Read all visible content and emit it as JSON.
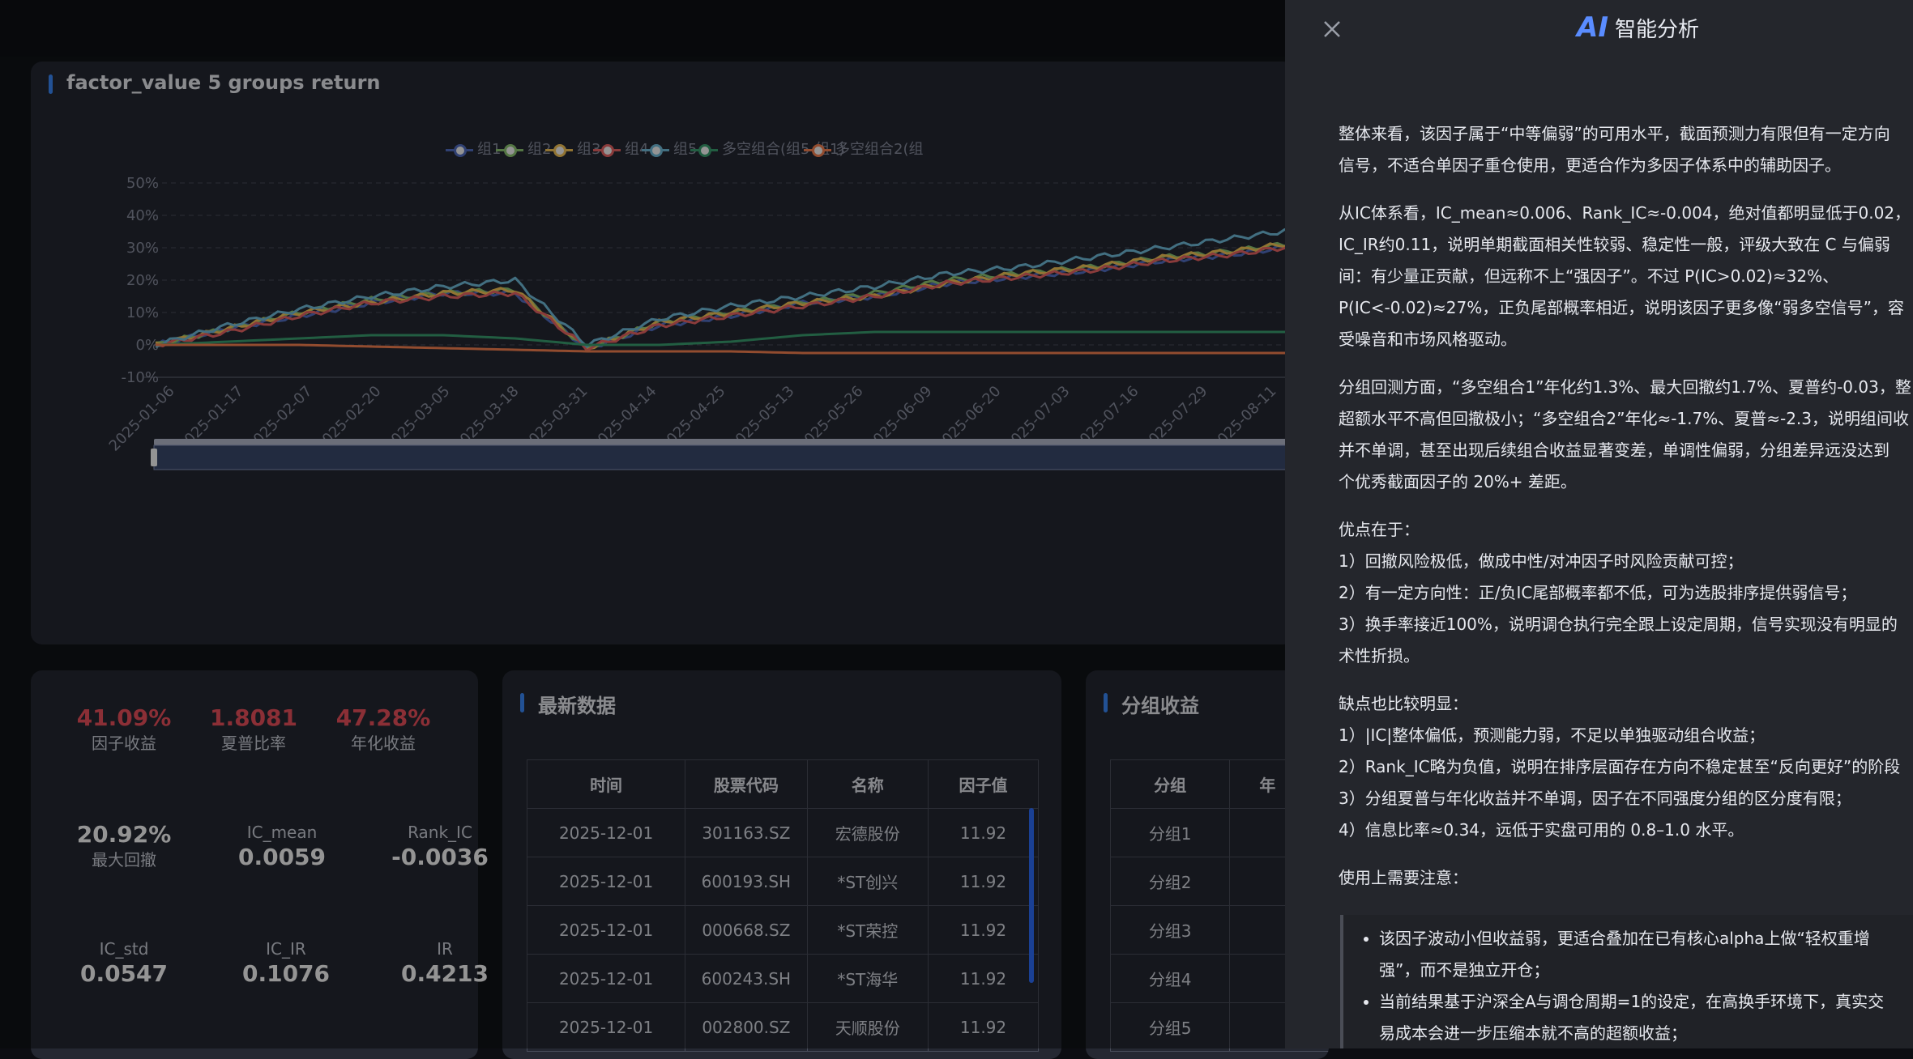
{
  "chart_card": {
    "title": "factor_value 5 groups return"
  },
  "chart_data": {
    "type": "line",
    "title": "factor_value 5 groups return",
    "ylim": [
      -10,
      50
    ],
    "yticks": [
      "50%",
      "40%",
      "30%",
      "20%",
      "10%",
      "0%",
      "-10%"
    ],
    "x": [
      "2025-01-06",
      "2025-01-17",
      "2025-02-07",
      "2025-02-20",
      "2025-03-05",
      "2025-03-18",
      "2025-03-31",
      "2025-04-14",
      "2025-04-25",
      "2025-05-13",
      "2025-05-26",
      "2025-06-09",
      "2025-06-20",
      "2025-07-03",
      "2025-07-16",
      "2025-07-29",
      "2025-08-11"
    ],
    "legend_position": "top-right",
    "grid": true,
    "series": [
      {
        "name": "组1",
        "color": "#5470c6",
        "values": [
          0,
          5,
          9,
          13,
          16,
          16,
          -1,
          6,
          9,
          13,
          15,
          19,
          21,
          23,
          26,
          28,
          31
        ]
      },
      {
        "name": "组2",
        "color": "#91cc75",
        "values": [
          0,
          5,
          10,
          14,
          16,
          17,
          -1,
          7,
          10,
          13,
          16,
          20,
          22,
          24,
          27,
          29,
          32
        ]
      },
      {
        "name": "组3",
        "color": "#fac858",
        "values": [
          0,
          5,
          10,
          13,
          16,
          17,
          -1,
          7,
          10,
          13,
          15,
          19,
          22,
          24,
          27,
          29,
          32
        ]
      },
      {
        "name": "组4",
        "color": "#ee6666",
        "values": [
          0,
          4,
          9,
          13,
          15,
          16,
          -1,
          6,
          9,
          12,
          15,
          19,
          21,
          23,
          26,
          28,
          31
        ]
      },
      {
        "name": "组5",
        "color": "#73c0de",
        "values": [
          0,
          6,
          11,
          15,
          18,
          20,
          0,
          8,
          12,
          15,
          18,
          22,
          24,
          27,
          30,
          33,
          36
        ]
      },
      {
        "name": "多空组合(组5-组1)",
        "color": "#3ba272",
        "values": [
          0,
          1,
          2,
          3,
          3,
          2,
          0,
          0,
          1,
          3,
          4,
          4,
          4,
          4,
          4,
          4,
          4
        ]
      },
      {
        "name": "多空组合2(组",
        "color": "#fc8452",
        "values": [
          0,
          0,
          0,
          -0.5,
          -1,
          -1.5,
          -2,
          -2,
          -2,
          -2.5,
          -2.5,
          -2.5,
          -2.5,
          -2.5,
          -2.5,
          -2.5,
          -2.5
        ]
      }
    ]
  },
  "stats": {
    "factor_return": {
      "value": "41.09%",
      "label": "因子收益"
    },
    "sharpe": {
      "value": "1.8081",
      "label": "夏普比率"
    },
    "annual_return": {
      "value": "47.28%",
      "label": "年化收益"
    },
    "max_drawdown": {
      "value": "20.92%",
      "label": "最大回撤"
    },
    "ic_mean": {
      "value": "0.0059",
      "label": "IC_mean"
    },
    "rank_ic": {
      "value": "-0.0036",
      "label": "Rank_IC"
    },
    "ic_std": {
      "value": "0.0547",
      "label": "IC_std"
    },
    "ic_ir": {
      "value": "0.1076",
      "label": "IC_IR"
    },
    "ir": {
      "value": "0.4213",
      "label": "IR"
    }
  },
  "latest": {
    "title": "最新数据",
    "headers": [
      "时间",
      "股票代码",
      "名称",
      "因子值"
    ],
    "rows": [
      [
        "2025-12-01",
        "301163.SZ",
        "宏德股份",
        "11.92"
      ],
      [
        "2025-12-01",
        "600193.SH",
        "*ST创兴",
        "11.92"
      ],
      [
        "2025-12-01",
        "000668.SZ",
        "*ST荣控",
        "11.92"
      ],
      [
        "2025-12-01",
        "600243.SH",
        "*ST海华",
        "11.92"
      ],
      [
        "2025-12-01",
        "002800.SZ",
        "天顺股份",
        "11.92"
      ]
    ]
  },
  "groups": {
    "title": "分组收益",
    "headers": [
      "分组",
      "年"
    ],
    "rows": [
      "分组1",
      "分组2",
      "分组3",
      "分组4",
      "分组5"
    ]
  },
  "ai": {
    "logo": "AI",
    "title": "智能分析",
    "paragraphs": [
      [
        "整体来看，该因子属于“中等偏弱”的可用水平，截面预测力有限但有一定方向",
        "信号，不适合单因子重仓使用，更适合作为多因子体系中的辅助因子。"
      ],
      [
        "从IC体系看，IC_mean≈0.006、Rank_IC≈-0.004，绝对值都明显低于0.02，",
        "IC_IR约0.11，说明单期截面相关性较弱、稳定性一般，评级大致在 C 与偏弱",
        "间：有少量正贡献，但远称不上“强因子”。不过 P(IC>0.02)≈32%、",
        "P(IC<-0.02)≈27%，正负尾部概率相近，说明该因子更多像“弱多空信号”，容",
        "受噪音和市场风格驱动。"
      ],
      [
        "分组回测方面，“多空组合1”年化约1.3%、最大回撤约1.7%、夏普约-0.03，整",
        "超额水平不高但回撤极小；“多空组合2”年化≈-1.7%、夏普≈-2.3，说明组间收",
        "并不单调，甚至出现后续组合收益显著变差，单调性偏弱，分组差异远没达到",
        "个优秀截面因子的 20%+ 差距。"
      ],
      [
        "优点在于：",
        "1）回撤风险极低，做成中性/对冲因子时风险贡献可控；",
        "2）有一定方向性：正/负IC尾部概率都不低，可为选股排序提供弱信号；",
        "3）换手率接近100%，说明调仓执行完全跟上设定周期，信号实现没有明显的",
        "术性折损。"
      ],
      [
        "缺点也比较明显：",
        "1）|IC|整体偏低，预测能力弱，不足以单独驱动组合收益；",
        "2）Rank_IC略为负值，说明在排序层面存在方向不稳定甚至“反向更好”的阶段",
        "3）分组夏普与年化收益并不单调，因子在不同强度分组的区分度有限；",
        "4）信息比率≈0.34，远低于实盘可用的 0.8–1.0 水平。"
      ],
      [
        "使用上需要注意："
      ]
    ],
    "notes": [
      "该因子波动小但收益弱，更适合叠加在已有核心alpha上做“轻权重增",
      "强”，而不是独立开仓；",
      "当前结果基于沪深全A与调仓周期=1的设定，在高换手环境下，真实交",
      "易成本会进一步压缩本就不高的超额收益；"
    ]
  }
}
